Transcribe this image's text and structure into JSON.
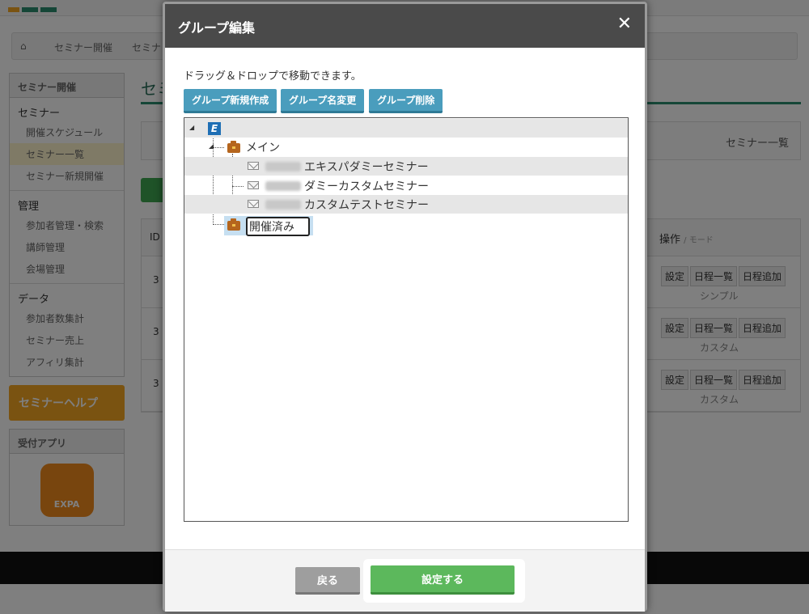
{
  "background": {
    "breadcrumb": [
      "セミナー開催",
      "セミナ"
    ],
    "sidebar": {
      "panel_title": "セミナー開催",
      "groups": [
        {
          "title": "セミナー",
          "items": [
            "開催スケジュール",
            "セミナー一覧",
            "セミナー新規開催"
          ]
        },
        {
          "title": "管理",
          "items": [
            "参加者管理・検索",
            "講師管理",
            "会場管理"
          ]
        },
        {
          "title": "データ",
          "items": [
            "参加者数集計",
            "セミナー売上",
            "アフィリ集計"
          ]
        }
      ],
      "help_label": "セミナーヘルプ",
      "app_title": "受付アプリ",
      "app_icon_text": "EXPA"
    },
    "page_title": "セミ",
    "info_link": "セミナー一覧",
    "table": {
      "id_header": "ID",
      "ops_header": "操作",
      "ops_sub": "/ モード",
      "rows": [
        {
          "id": "3",
          "ops": [
            "設定",
            "日程一覧",
            "日程追加"
          ],
          "mode": "シンプル"
        },
        {
          "id": "3",
          "ops": [
            "設定",
            "日程一覧",
            "日程追加"
          ],
          "mode": "カスタム"
        },
        {
          "id": "3",
          "ops": [
            "設定",
            "日程一覧",
            "日程追加"
          ],
          "mode": "カスタム"
        }
      ]
    }
  },
  "modal": {
    "title": "グループ編集",
    "close_symbol": "✕",
    "hint": "ドラッグ＆ドロップで移動できます。",
    "toolbar": {
      "new_group": "グループ新規作成",
      "rename_group": "グループ名変更",
      "delete_group": "グループ削除"
    },
    "tree": {
      "root_icon": "E",
      "groups": [
        {
          "name": "メイン",
          "items": [
            "エキスパダミーセミナー",
            "ダミーカスタムセミナー",
            "カスタムテストセミナー"
          ]
        }
      ],
      "editing_group_value": "開催済み"
    },
    "footer": {
      "back": "戻る",
      "submit": "設定する"
    }
  }
}
